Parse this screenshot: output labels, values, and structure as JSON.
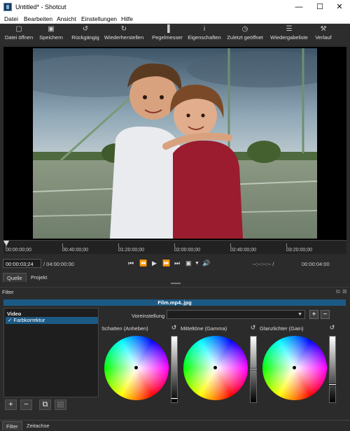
{
  "window": {
    "title": "Untitled* - Shotcut",
    "minimize": "—",
    "maximize": "☐",
    "close": "✕"
  },
  "menu": [
    "Datei",
    "Bearbeiten",
    "Ansicht",
    "Einstellungen",
    "Hilfe"
  ],
  "toolbar": [
    {
      "label": "Datei öffnen",
      "icon": "folder-open-icon",
      "glyph": "▢"
    },
    {
      "label": "Speichern",
      "icon": "save-icon",
      "glyph": "▣"
    },
    {
      "label": "Rückgängig",
      "icon": "undo-icon",
      "glyph": "↺"
    },
    {
      "label": "Wiederherstellen",
      "icon": "redo-icon",
      "glyph": "↻"
    },
    {
      "label": "Pegelmesser",
      "icon": "meter-icon",
      "glyph": "▐"
    },
    {
      "label": "Eigenschaften",
      "icon": "info-icon",
      "glyph": "i"
    },
    {
      "label": "Zuletzt geöffnet",
      "icon": "clock-icon",
      "glyph": "◷"
    },
    {
      "label": "Wiedergabeliste",
      "icon": "playlist-icon",
      "glyph": "☰"
    },
    {
      "label": "Verlauf",
      "icon": "history-icon",
      "glyph": "⚒"
    }
  ],
  "ruler": [
    "00:00:00;00",
    "00:40:00;00",
    "01:20:00;00",
    "02:00:00;00",
    "02:40:00;00",
    "03:20:00;00"
  ],
  "transport": {
    "position": "00:00:03;24",
    "duration": "/ 04:00:00:00",
    "in_out": "--:--:--:-- /",
    "out_time": "00:00:04:00"
  },
  "tabs": {
    "source": "Quelle",
    "project": "Projekt"
  },
  "filter": {
    "header": "Filter",
    "bar_title": "Film.mp4..jpg",
    "list_heading": "Video",
    "item_check": "✓",
    "item": "Farbkorrektur",
    "preset_label": "Voreinstellung",
    "preset_value": "",
    "wheels": [
      {
        "label": "Schatten (Anheben)",
        "level": 0.02
      },
      {
        "label": "Mitteltöne (Gamma)",
        "level": 0.5
      },
      {
        "label": "Glanzlichter (Gain)",
        "level": 0.25
      }
    ]
  },
  "bottom_tabs": {
    "filter": "Filter",
    "timeline": "Zeitachse"
  }
}
